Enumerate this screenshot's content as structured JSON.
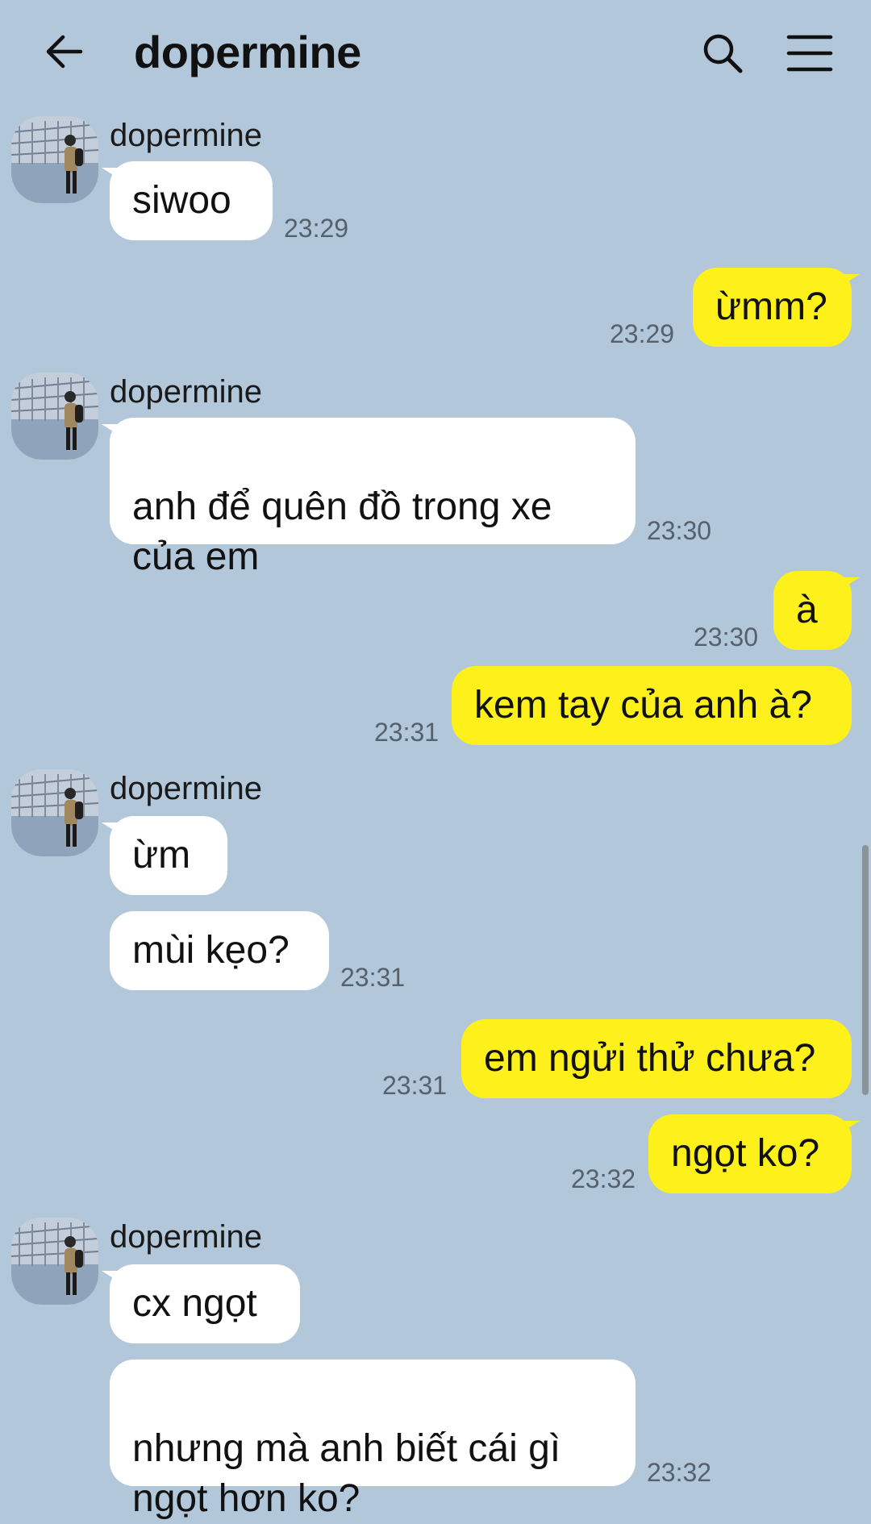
{
  "header": {
    "title": "dopermine",
    "back_icon": "arrow-left-icon",
    "search_icon": "search-icon",
    "menu_icon": "hamburger-menu-icon"
  },
  "colors": {
    "background": "#b2c7d9",
    "incoming_bubble": "#ffffff",
    "outgoing_bubble": "#fef01b"
  },
  "messages": [
    {
      "sender": "dopermine",
      "text": "siwoo",
      "time": "23:29"
    },
    {
      "text": "ừmm?",
      "time": "23:29"
    },
    {
      "sender": "dopermine",
      "text": "anh để quên đồ trong xe\ncủa em",
      "time": "23:30"
    },
    {
      "text": "à",
      "time": "23:30"
    },
    {
      "text": "kem tay của anh à?",
      "time": "23:31"
    },
    {
      "sender": "dopermine",
      "text": "ừm"
    },
    {
      "text": "mùi kẹo?",
      "time": "23:31"
    },
    {
      "text": "em ngửi thử chưa?",
      "time": "23:31"
    },
    {
      "text": "ngọt ko?",
      "time": "23:32"
    },
    {
      "sender": "dopermine",
      "text": "cx ngọt"
    },
    {
      "text": "nhưng mà anh biết cái gì\nngọt hơn ko?",
      "time": "23:32"
    }
  ]
}
